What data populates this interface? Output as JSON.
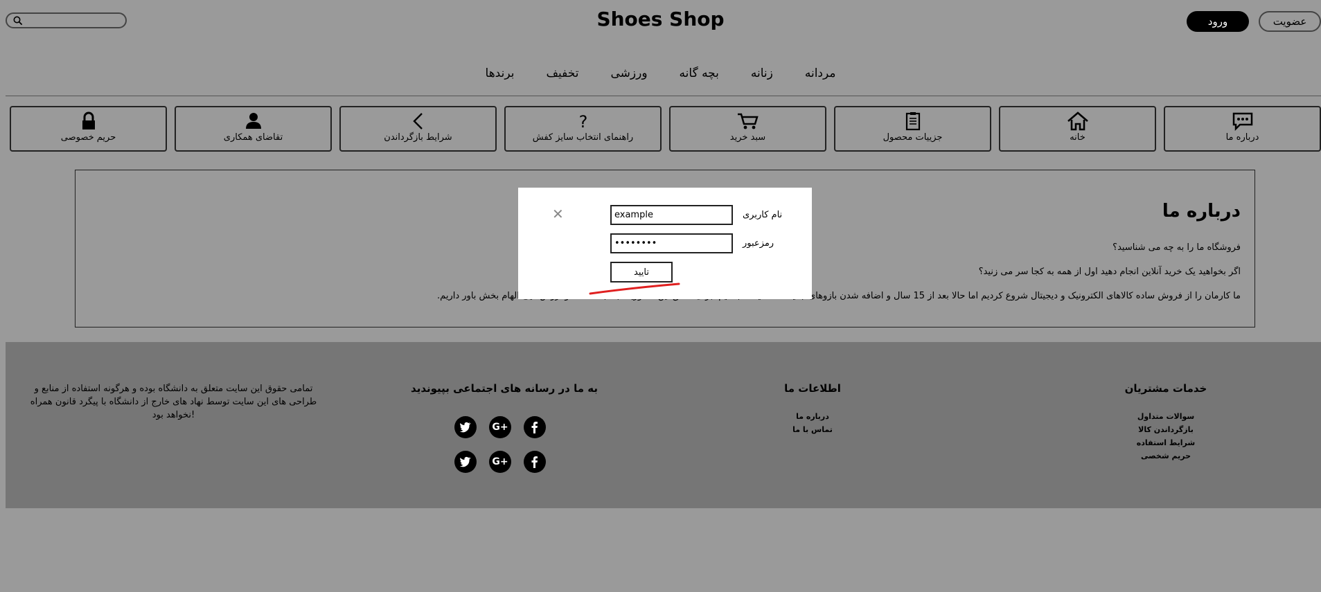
{
  "header": {
    "brand": "Shoes Shop",
    "login_label": "ورود",
    "join_label": "عضویت"
  },
  "categories": [
    "مردانه",
    "زنانه",
    "بچه گانه",
    "ورزشی",
    "تخفیف",
    "برندها"
  ],
  "tabs": [
    {
      "label": "درباره ما",
      "icon": "chat-icon"
    },
    {
      "label": "خانه",
      "icon": "home-icon"
    },
    {
      "label": "جزییات محصول",
      "icon": "clipboard-icon"
    },
    {
      "label": "سبد خرید",
      "icon": "cart-icon"
    },
    {
      "label": "راهنمای انتخاب سایز کفش",
      "icon": "question-icon"
    },
    {
      "label": "شرایط بازگرداندن",
      "icon": "chevron-left-icon"
    },
    {
      "label": "تقاضای همکاری",
      "icon": "user-icon"
    },
    {
      "label": "حریم خصوصی",
      "icon": "lock-icon"
    }
  ],
  "about": {
    "title": "درباره ما",
    "line1": "فروشگاه ما را به چه می شناسید؟",
    "line2": "اگر بخواهید یک خرید آنلاین انجام دهید اول از همه به کجا سر می زنید؟",
    "line3": "ما کارمان را از فروش ساده کالاهای الکترونیک و دیجیتال شروع کردیم اما حالا بعد از 15 سال و اضافه شدن بازوهای جدید ... صمیمانه باشیم. برای تحقق این ماموریت به لبخند شما و ارزش‌هایی الهام بخش باور داریم."
  },
  "modal": {
    "username_label": "نام کاربری",
    "password_label": "رمزعبور",
    "username_value": "example",
    "password_value": "••••••••",
    "confirm_label": "تایید"
  },
  "footer": {
    "customer_services": {
      "title": "خدمات مشتریان",
      "links": [
        "سوالات متداول",
        "بازگرداندن کالا",
        "شرایط استفاده",
        "حریم شخصی"
      ]
    },
    "about_us": {
      "title": "اطلاعات ما",
      "links": [
        "درباره ما",
        "تماس با ما"
      ]
    },
    "social": {
      "title": "به ما در رسانه های اجتماعی بپیوندید"
    },
    "copyright": "تمامی حقوق این سایت متعلق به دانشگاه بوده و هرگونه استفاده از منابع و طراحی های این سایت توسط نهاد های خارج از دانشگاه با پیگرد قانون همراه !نخواهد بود"
  }
}
